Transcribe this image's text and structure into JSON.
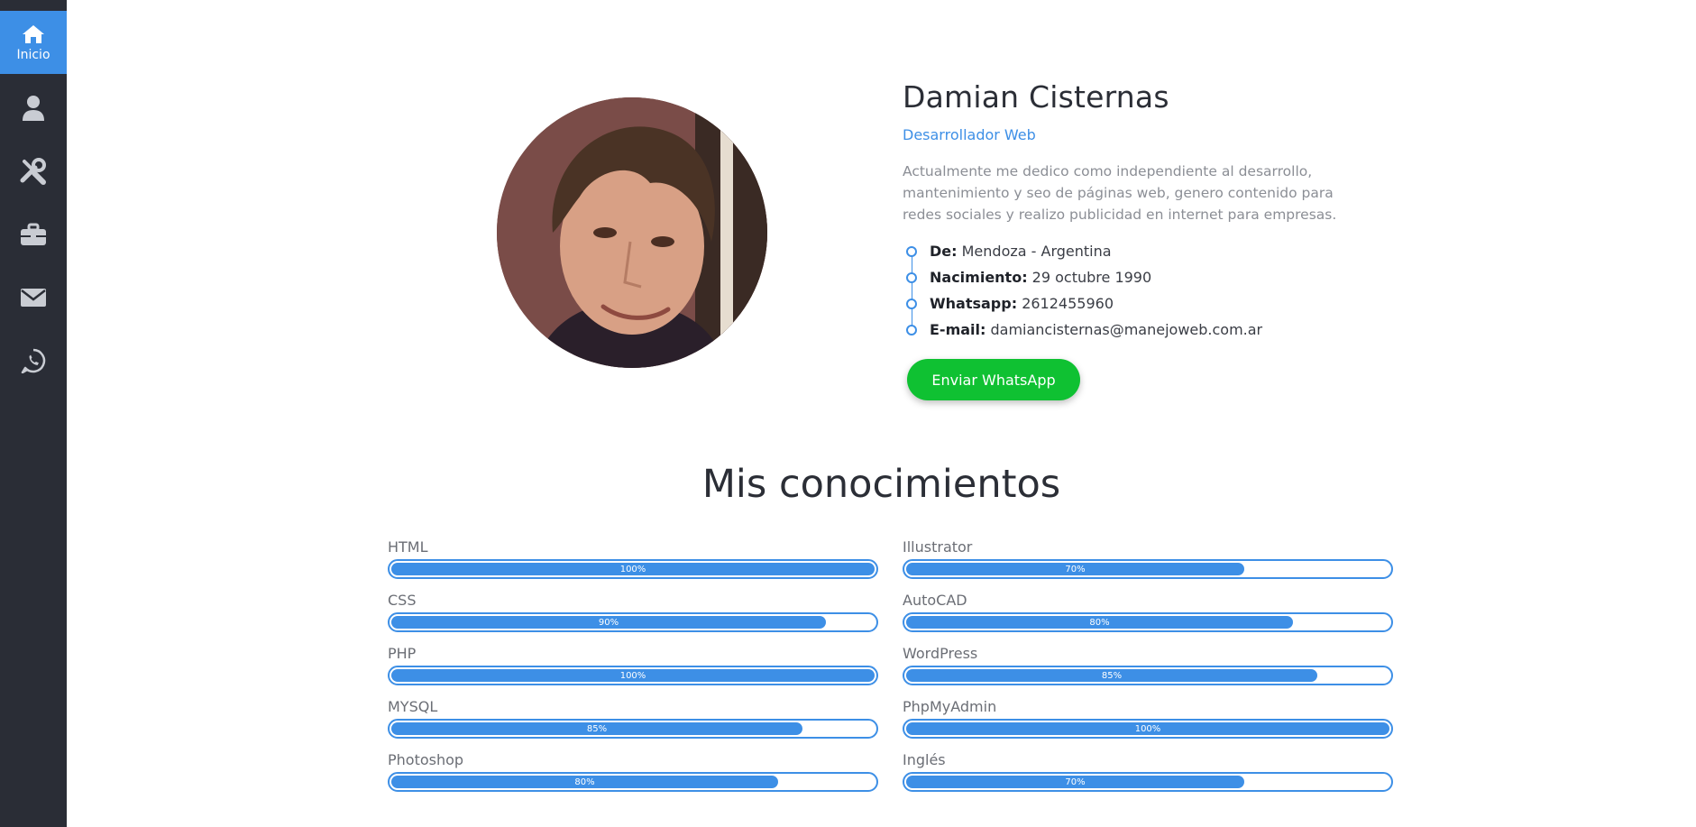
{
  "sidebar": {
    "items": [
      {
        "icon": "home-icon",
        "label": "Inicio",
        "active": true
      },
      {
        "icon": "user-icon",
        "label": "",
        "active": false
      },
      {
        "icon": "tools-icon",
        "label": "",
        "active": false
      },
      {
        "icon": "briefcase-icon",
        "label": "",
        "active": false
      },
      {
        "icon": "envelope-icon",
        "label": "",
        "active": false
      },
      {
        "icon": "whatsapp-icon",
        "label": "",
        "active": false
      }
    ]
  },
  "profile": {
    "name": "Damian Cisternas",
    "role": "Desarrollador Web",
    "bio": "Actualmente me dedico como independiente al desarrollo, mantenimiento y seo de páginas web, genero contenido para redes sociales y realizo publicidad en internet para empresas.",
    "info": [
      {
        "label": "De:",
        "value": " Mendoza - Argentina"
      },
      {
        "label": "Nacimiento:",
        "value": " 29 octubre 1990"
      },
      {
        "label": "Whatsapp:",
        "value": " 2612455960"
      },
      {
        "label": "E-mail:",
        "value": " damiancisternas@manejoweb.com.ar"
      }
    ],
    "button_label": "Enviar WhatsApp"
  },
  "skills_section": {
    "title": "Mis conocimientos",
    "left": [
      {
        "name": "HTML",
        "percent": 100,
        "label": "100%"
      },
      {
        "name": "CSS",
        "percent": 90,
        "label": "90%"
      },
      {
        "name": "PHP",
        "percent": 100,
        "label": "100%"
      },
      {
        "name": "MYSQL",
        "percent": 85,
        "label": "85%"
      },
      {
        "name": "Photoshop",
        "percent": 80,
        "label": "80%"
      }
    ],
    "right": [
      {
        "name": "Illustrator",
        "percent": 70,
        "label": "70%"
      },
      {
        "name": "AutoCAD",
        "percent": 80,
        "label": "80%"
      },
      {
        "name": "WordPress",
        "percent": 85,
        "label": "85%"
      },
      {
        "name": "PhpMyAdmin",
        "percent": 100,
        "label": "100%"
      },
      {
        "name": "Inglés",
        "percent": 70,
        "label": "70%"
      }
    ]
  },
  "colors": {
    "accent": "#3d8fe6",
    "sidebar_bg": "#2a2d36",
    "whatsapp_green": "#0fc132"
  }
}
